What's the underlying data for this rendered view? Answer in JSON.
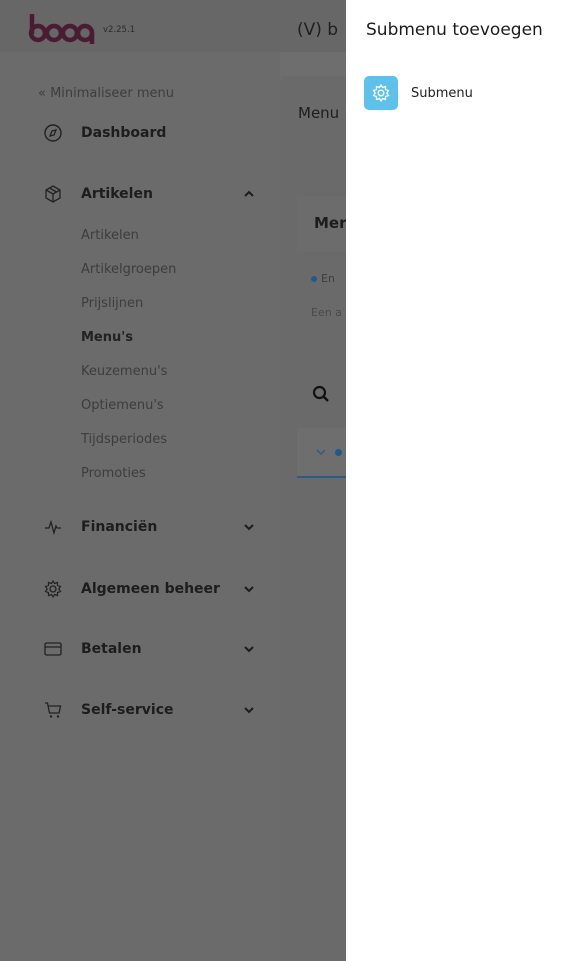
{
  "app": {
    "version": "v2.25.1",
    "top_title": "(V) b"
  },
  "sidebar": {
    "minimize_label": "« Minimaliseer menu",
    "items": [
      {
        "label": "Dashboard",
        "icon": "compass-icon"
      },
      {
        "label": "Artikelen",
        "icon": "box-icon",
        "expanded": true,
        "children": [
          "Artikelen",
          "Artikelgroepen",
          "Prijslijnen",
          "Menu's",
          "Keuzemenu's",
          "Optiemenu's",
          "Tijdsperiodes",
          "Promoties"
        ],
        "active_child": "Menu's"
      },
      {
        "label": "Financiën",
        "icon": "pulse-icon"
      },
      {
        "label": "Algemeen beheer",
        "icon": "gear-icon"
      },
      {
        "label": "Betalen",
        "icon": "card-icon"
      },
      {
        "label": "Self-service",
        "icon": "cart-icon"
      }
    ]
  },
  "content": {
    "title": "Menu",
    "card_title": "Mer",
    "bullet_text": "En",
    "gray_text": "Een a"
  },
  "panel": {
    "title": "Submenu toevoegen",
    "option_label": "Submenu",
    "option_icon": "gear-icon",
    "accent": "#5ec1ec"
  }
}
